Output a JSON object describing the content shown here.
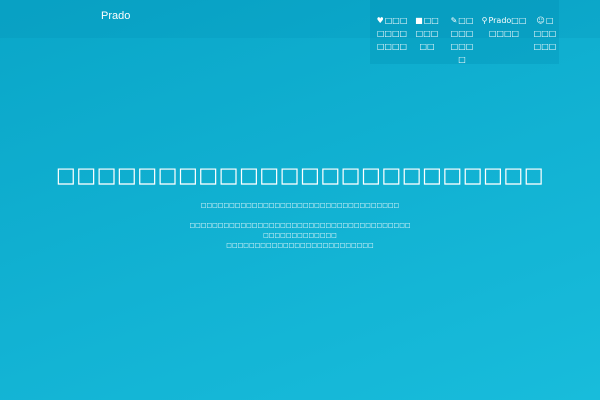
{
  "brand": "Prado",
  "nav": {
    "items": [
      {
        "icon": "♥",
        "label": "□□□□□□□□□□□",
        "icon_name": "heart-icon"
      },
      {
        "icon": "■",
        "label": "□□□□□□□",
        "icon_name": "book-icon"
      },
      {
        "icon": "✎",
        "label": "□□□□□□□□□",
        "icon_name": "edit-icon"
      },
      {
        "icon": "⚲",
        "label": "Prado□□□□□□",
        "icon_name": "map-marker-icon"
      },
      {
        "icon": "☺",
        "label": "□□□□□□□",
        "icon_name": "smile-icon"
      }
    ]
  },
  "hero": {
    "title": "□□□□□□□□□□□□□□□□□□□□□□□□",
    "subtitle": "□□□□□□□□□□□□□□□□□□□□□□□□□□□□□□□□□□□",
    "description_lines": [
      "□□□□□□□□□□□□□□□□□□□□□□□□□□□□□□□□□□□□□□□",
      "□□□□□□□□□□□□□",
      "□□□□□□□□□□□□□□□□□□□□□□□□□□"
    ]
  },
  "colors": {
    "background_start": "#0aa6c8",
    "background_end": "#18bcdb",
    "text": "#ffffff"
  }
}
